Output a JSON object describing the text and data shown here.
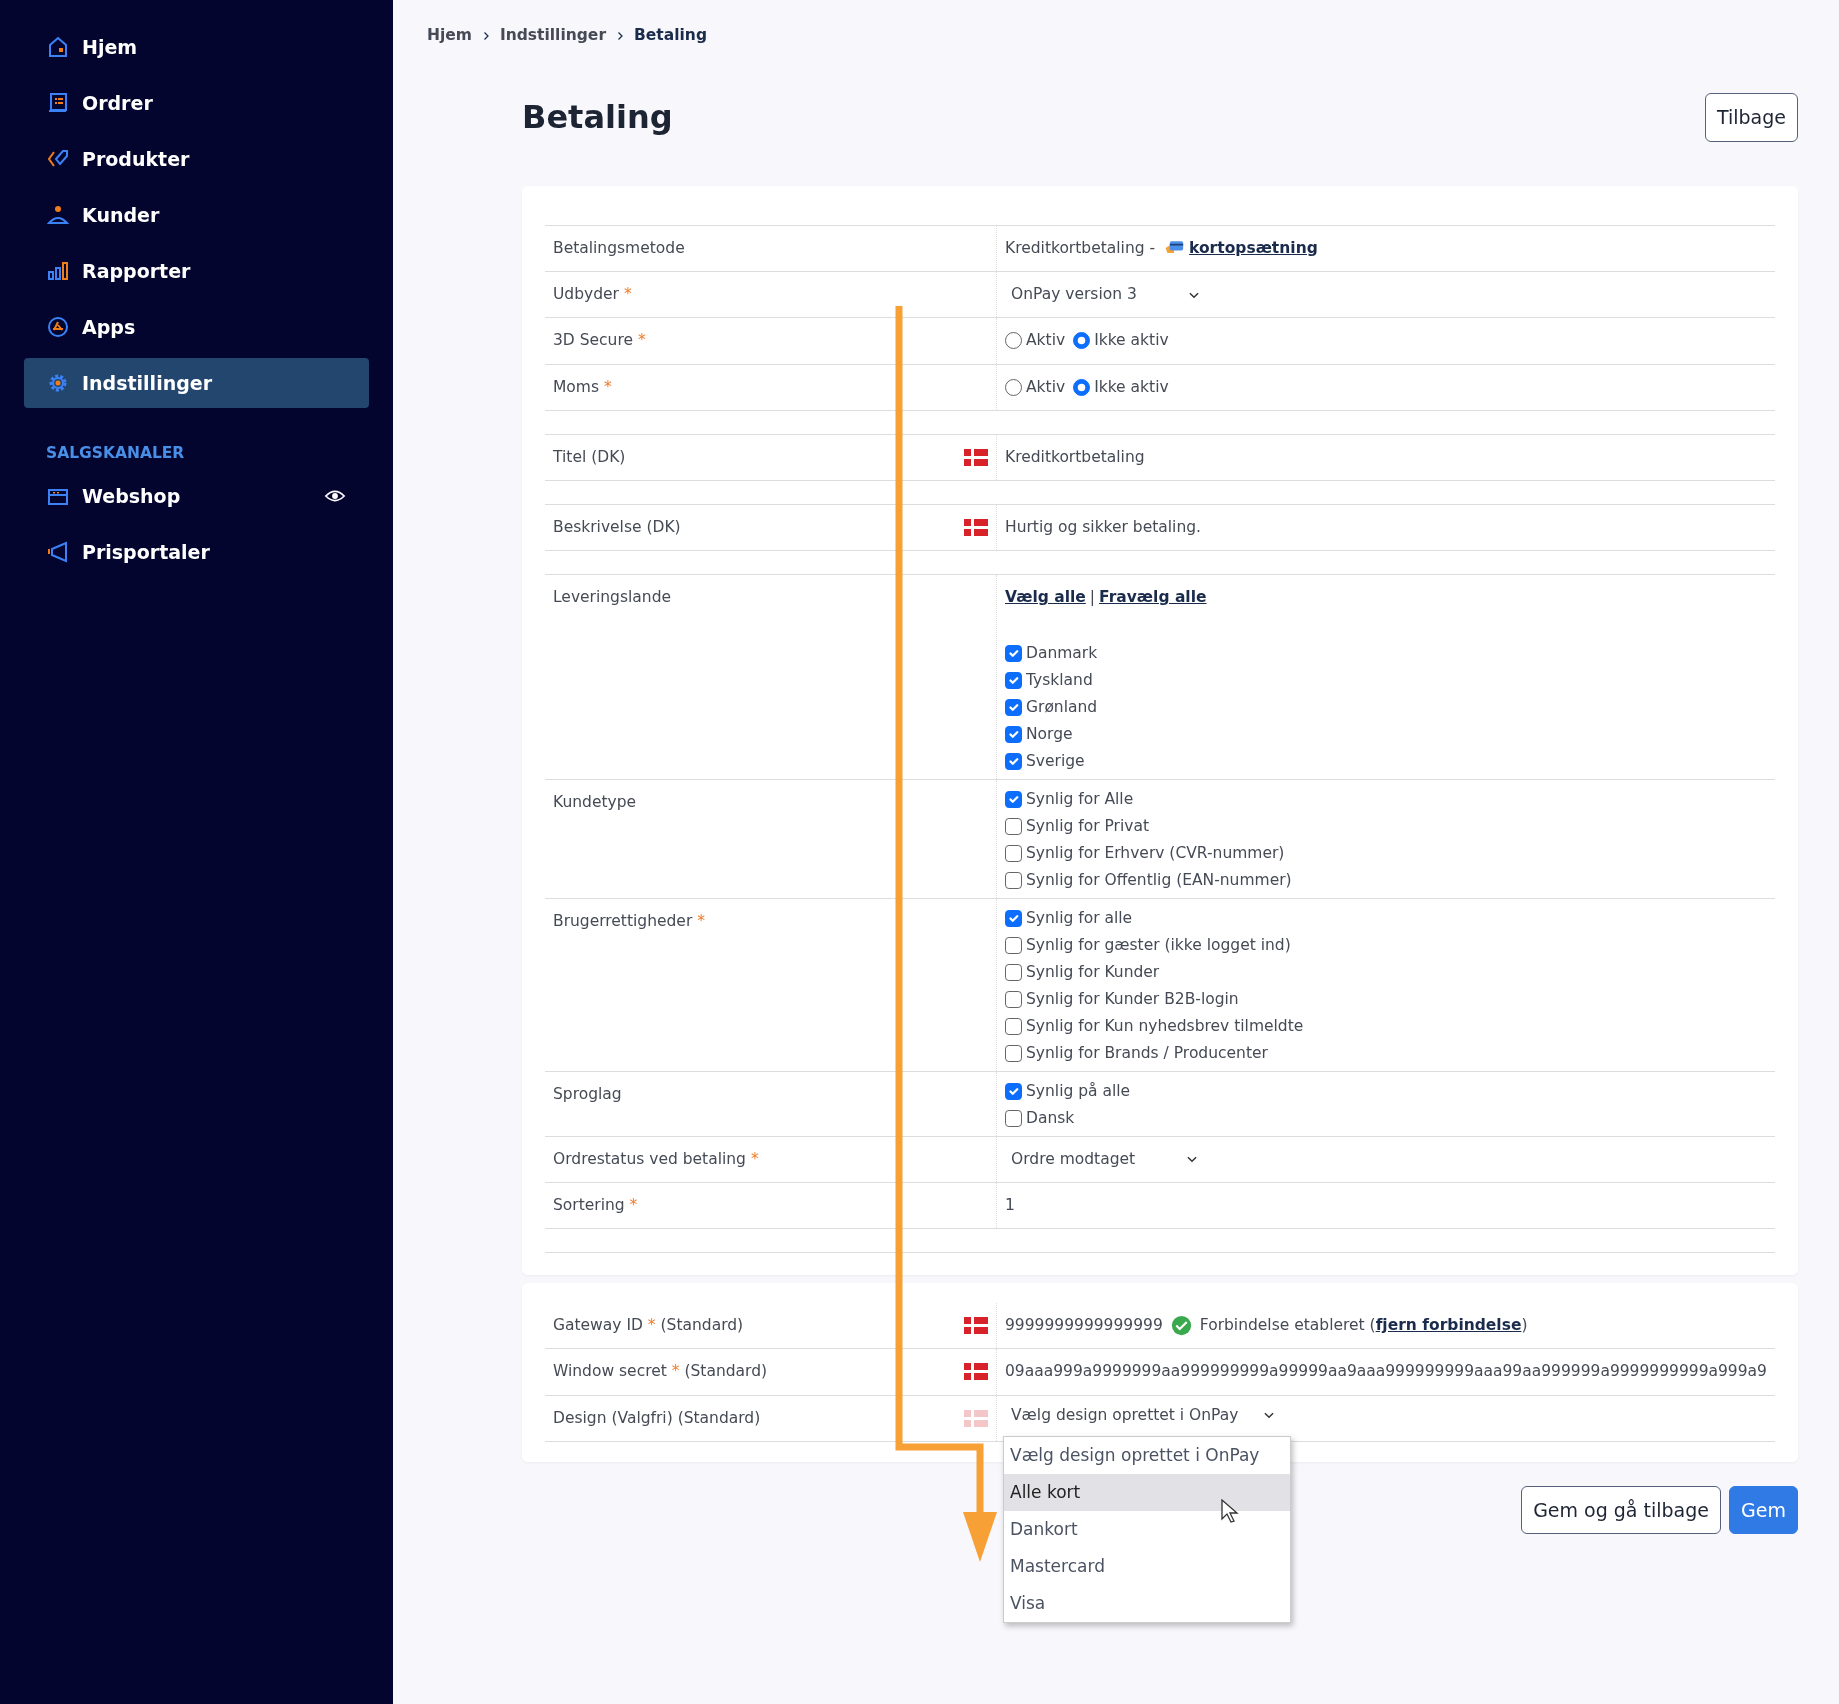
{
  "sidebar": {
    "items": [
      {
        "label": "Hjem",
        "selected": false
      },
      {
        "label": "Ordrer",
        "selected": false
      },
      {
        "label": "Produkter",
        "selected": false
      },
      {
        "label": "Kunder",
        "selected": false
      },
      {
        "label": "Rapporter",
        "selected": false
      },
      {
        "label": "Apps",
        "selected": false
      },
      {
        "label": "Indstillinger",
        "selected": true
      }
    ],
    "section_title": "SALGSKANALER",
    "channels": [
      {
        "label": "Webshop",
        "preview": true
      },
      {
        "label": "Prisportaler",
        "preview": false
      }
    ]
  },
  "breadcrumb": [
    {
      "label": "Hjem",
      "kind": "link"
    },
    {
      "label": "Indstillinger",
      "kind": "link"
    },
    {
      "label": "Betaling",
      "kind": "current"
    }
  ],
  "page_title": "Betaling",
  "back_button": "Tilbage",
  "form": {
    "rows": [
      {
        "kind": "method",
        "label": "Betalingsmetode",
        "value": "Kreditkortbetaling -",
        "link": "kortopsætning"
      },
      {
        "kind": "select",
        "label": "Udbyder",
        "required_mark": "*",
        "value": "OnPay version 3"
      },
      {
        "kind": "radio",
        "label": "3D Secure",
        "required_mark": "*",
        "options": [
          {
            "label": "Aktiv",
            "selected": false
          },
          {
            "label": "Ikke aktiv",
            "selected": true
          }
        ]
      },
      {
        "kind": "radio",
        "label": "Moms",
        "required_mark": "*",
        "options": [
          {
            "label": "Aktiv",
            "selected": false
          },
          {
            "label": "Ikke aktiv",
            "selected": true
          }
        ],
        "gap_after": true
      },
      {
        "kind": "text",
        "label": "Titel (DK)",
        "flag": true,
        "value": "Kreditkortbetaling",
        "gap_after": true
      },
      {
        "kind": "text",
        "label": "Beskrivelse (DK)",
        "flag": true,
        "value": "Hurtig og sikker betaling.",
        "gap_after": true
      },
      {
        "kind": "checks",
        "label": "Leveringslande",
        "links": [
          "Vælg alle",
          "Fravælg alle"
        ],
        "separator": "|",
        "options": [
          {
            "label": "Danmark",
            "checked": true
          },
          {
            "label": "Tyskland",
            "checked": true
          },
          {
            "label": "Grønland",
            "checked": true
          },
          {
            "label": "Norge",
            "checked": true
          },
          {
            "label": "Sverige",
            "checked": true
          }
        ]
      },
      {
        "kind": "checks",
        "label": "Kundetype",
        "options": [
          {
            "label": "Synlig for Alle",
            "checked": true
          },
          {
            "label": "Synlig for Privat",
            "checked": false
          },
          {
            "label": "Synlig for Erhverv (CVR-nummer)",
            "checked": false
          },
          {
            "label": "Synlig for Offentlig (EAN-nummer)",
            "checked": false
          }
        ]
      },
      {
        "kind": "checks",
        "label": "Brugerrettigheder",
        "required_mark": "*",
        "options": [
          {
            "label": "Synlig for alle",
            "checked": true
          },
          {
            "label": "Synlig for gæster (ikke logget ind)",
            "checked": false
          },
          {
            "label": "Synlig for Kunder",
            "checked": false
          },
          {
            "label": "Synlig for Kunder B2B-login",
            "checked": false
          },
          {
            "label": "Synlig for Kun nyhedsbrev tilmeldte",
            "checked": false
          },
          {
            "label": "Synlig for Brands / Producenter",
            "checked": false
          }
        ]
      },
      {
        "kind": "checks",
        "label": "Sproglag",
        "options": [
          {
            "label": "Synlig på alle",
            "checked": true
          },
          {
            "label": "Dansk",
            "checked": false
          }
        ]
      },
      {
        "kind": "select",
        "label": "Ordrestatus ved betaling",
        "required_mark": "*",
        "value": "Ordre modtaget"
      },
      {
        "kind": "text",
        "label": "Sortering",
        "required_mark": "*",
        "value": "1",
        "gap_after": true
      }
    ]
  },
  "gateway": {
    "rows": [
      {
        "kind": "gateway",
        "label": "Gateway ID",
        "required_mark": "*",
        "suffix": "(Standard)",
        "flag": true,
        "value": "9999999999999999",
        "status": "Forbindelse etableret (",
        "link": "fjern forbindelse",
        "status_end": ")"
      },
      {
        "kind": "text",
        "label": "Window secret",
        "required_mark": "*",
        "suffix": "(Standard)",
        "flag": true,
        "value": "09aaa999a9999999aa999999999a99999aa9aaa999999999aaa99aa999999a9999999999a999a9"
      },
      {
        "kind": "design",
        "label": "Design (Valgfri) (Standard)",
        "flag": true,
        "value": "Vælg design oprettet i OnPay",
        "expanded": true,
        "options": [
          {
            "label": "Vælg design oprettet i OnPay",
            "highlighted": false
          },
          {
            "label": "Alle kort",
            "highlighted": true
          },
          {
            "label": "Dankort",
            "highlighted": false
          },
          {
            "label": "Mastercard",
            "highlighted": false
          },
          {
            "label": "Visa",
            "highlighted": false
          }
        ]
      }
    ]
  },
  "buttons": [
    {
      "label": "Gem og gå tilbage",
      "kind": "secondary"
    },
    {
      "label": "Gem",
      "kind": "primary"
    }
  ]
}
